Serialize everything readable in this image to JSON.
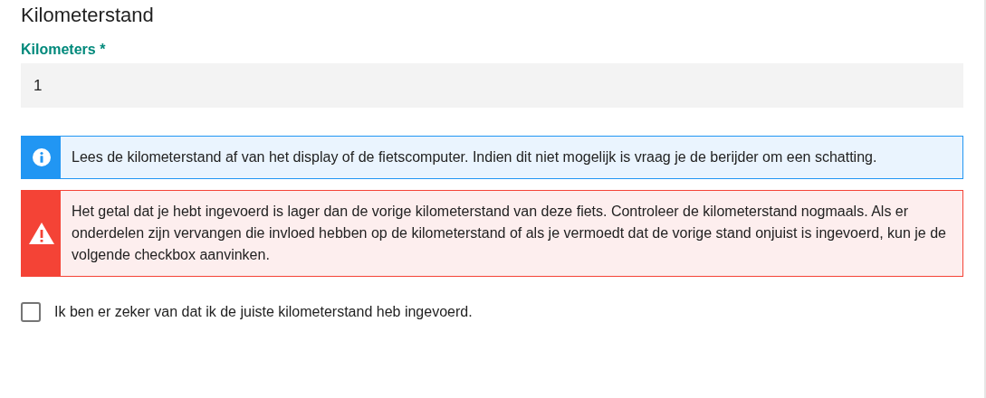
{
  "title": "Kilometerstand",
  "field": {
    "label": "Kilometers *",
    "value": "1"
  },
  "alerts": [
    {
      "kind": "info",
      "text": "Lees de kilometerstand af van het display of de fietscomputer. Indien dit niet mogelijk is vraag je de berijder om een schatting."
    },
    {
      "kind": "warning",
      "text": "Het getal dat je hebt ingevoerd is lager dan de vorige kilometerstand van deze fiets. Controleer de kilometerstand nogmaals. Als er onderdelen zijn vervangen die invloed hebben op de kilometerstand of als je vermoedt dat de vorige stand onjuist is ingevoerd, kun je de volgende checkbox aanvinken."
    }
  ],
  "checkbox": {
    "label": "Ik ben er zeker van dat ik de juiste kilometerstand heb ingevoerd.",
    "checked": false
  }
}
